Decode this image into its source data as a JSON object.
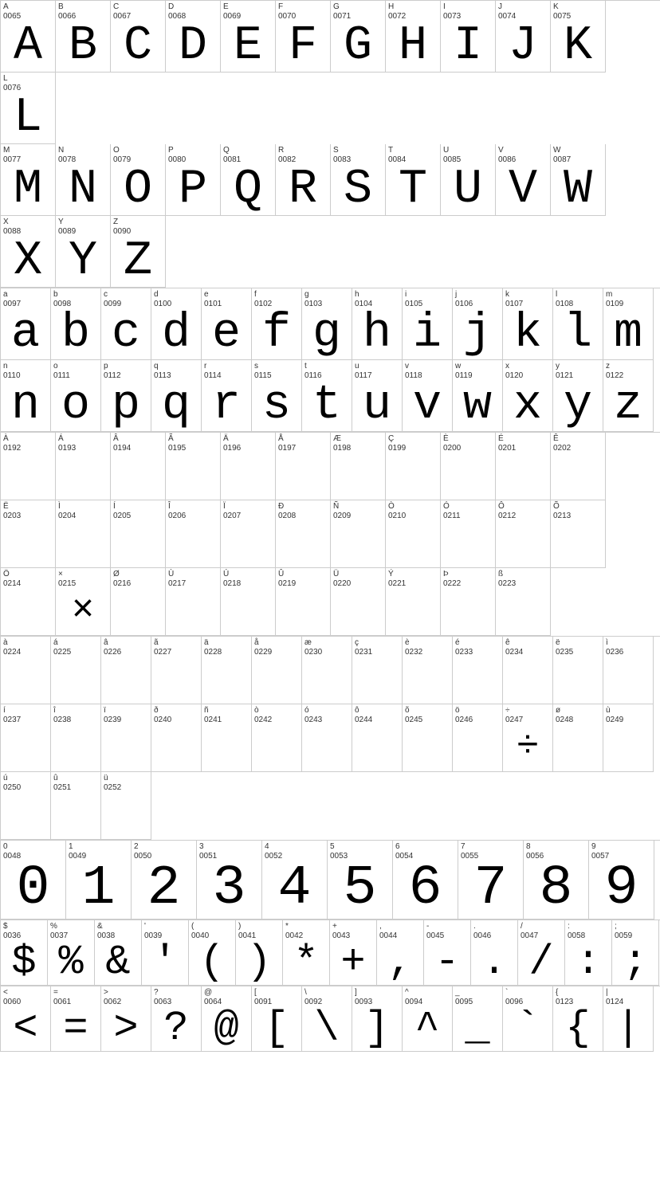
{
  "sections": [
    {
      "id": "uppercase",
      "rows": [
        {
          "cols": 12,
          "cells": [
            {
              "code": "A\n0065",
              "char": "A"
            },
            {
              "code": "B\n0066",
              "char": "B"
            },
            {
              "code": "C\n0067",
              "char": "C"
            },
            {
              "code": "D\n0068",
              "char": "D"
            },
            {
              "code": "E\n0069",
              "char": "E"
            },
            {
              "code": "F\n0070",
              "char": "F"
            },
            {
              "code": "G\n0071",
              "char": "G"
            },
            {
              "code": "H\n0072",
              "char": "H"
            },
            {
              "code": "I\n0073",
              "char": "I"
            },
            {
              "code": "J\n0074",
              "char": "J"
            },
            {
              "code": "K\n0075",
              "char": "K"
            },
            {
              "code": "L\n0076",
              "char": "L"
            }
          ]
        },
        {
          "cols": 12,
          "cells": [
            {
              "code": "M\n0077",
              "char": "M"
            },
            {
              "code": "N\n0078",
              "char": "N"
            },
            {
              "code": "O\n0079",
              "char": "O"
            },
            {
              "code": "P\n0080",
              "char": "P"
            },
            {
              "code": "Q\n0081",
              "char": "Q"
            },
            {
              "code": "R\n0082",
              "char": "R"
            },
            {
              "code": "S\n0083",
              "char": "S"
            },
            {
              "code": "T\n0084",
              "char": "T"
            },
            {
              "code": "U\n0085",
              "char": "U"
            },
            {
              "code": "V\n0086",
              "char": "V"
            },
            {
              "code": "W\n0087",
              "char": "W"
            }
          ]
        },
        {
          "cols": 12,
          "cells": [
            {
              "code": "X\n0088",
              "char": "X"
            },
            {
              "code": "Y\n0089",
              "char": "Y"
            },
            {
              "code": "Z\n0090",
              "char": "Z"
            }
          ]
        }
      ]
    },
    {
      "id": "lowercase",
      "rows": [
        {
          "cols": 13,
          "cells": [
            {
              "code": "a\n0097",
              "char": "a"
            },
            {
              "code": "b\n0098",
              "char": "b"
            },
            {
              "code": "c\n0099",
              "char": "c"
            },
            {
              "code": "d\n0100",
              "char": "d"
            },
            {
              "code": "e\n0101",
              "char": "e"
            },
            {
              "code": "f\n0102",
              "char": "f"
            },
            {
              "code": "g\n0103",
              "char": "g"
            },
            {
              "code": "h\n0104",
              "char": "h"
            },
            {
              "code": "i\n0105",
              "char": "i"
            },
            {
              "code": "j\n0106",
              "char": "j"
            },
            {
              "code": "k\n0107",
              "char": "k"
            },
            {
              "code": "l\n0108",
              "char": "l"
            },
            {
              "code": "m\n0109",
              "char": "m"
            }
          ]
        },
        {
          "cols": 13,
          "cells": [
            {
              "code": "n\n0110",
              "char": "n"
            },
            {
              "code": "o\n0111",
              "char": "o"
            },
            {
              "code": "p\n0112",
              "char": "p"
            },
            {
              "code": "q\n0113",
              "char": "q"
            },
            {
              "code": "r\n0114",
              "char": "r"
            },
            {
              "code": "s\n0115",
              "char": "s"
            },
            {
              "code": "t\n0116",
              "char": "t"
            },
            {
              "code": "u\n0117",
              "char": "u"
            },
            {
              "code": "v\n0118",
              "char": "v"
            },
            {
              "code": "w\n0119",
              "char": "w"
            },
            {
              "code": "x\n0120",
              "char": "x"
            },
            {
              "code": "y\n0121",
              "char": "y"
            },
            {
              "code": "z\n0122",
              "char": "z"
            }
          ]
        }
      ]
    },
    {
      "id": "extended1",
      "rows": [
        {
          "cols": 12,
          "cells": [
            {
              "code": "À\n0192",
              "char": ""
            },
            {
              "code": "Á\n0193",
              "char": ""
            },
            {
              "code": "Â\n0194",
              "char": ""
            },
            {
              "code": "Ã\n0195",
              "char": ""
            },
            {
              "code": "Ä\n0196",
              "char": ""
            },
            {
              "code": "Å\n0197",
              "char": ""
            },
            {
              "code": "Æ\n0198",
              "char": ""
            },
            {
              "code": "Ç\n0199",
              "char": ""
            },
            {
              "code": "È\n0200",
              "char": ""
            },
            {
              "code": "É\n0201",
              "char": ""
            },
            {
              "code": "Ê\n0202",
              "char": ""
            }
          ]
        },
        {
          "cols": 12,
          "cells": [
            {
              "code": "Ë\n0203",
              "char": ""
            },
            {
              "code": "Ì\n0204",
              "char": ""
            },
            {
              "code": "Í\n0205",
              "char": ""
            },
            {
              "code": "Î\n0206",
              "char": ""
            },
            {
              "code": "Ï\n0207",
              "char": ""
            },
            {
              "code": "Ð\n0208",
              "char": ""
            },
            {
              "code": "Ñ\n0209",
              "char": ""
            },
            {
              "code": "Ò\n0210",
              "char": ""
            },
            {
              "code": "Ó\n0211",
              "char": ""
            },
            {
              "code": "Ô\n0212",
              "char": ""
            },
            {
              "code": "Õ\n0213",
              "char": ""
            }
          ]
        },
        {
          "cols": 12,
          "cells": [
            {
              "code": "Ö\n0214",
              "char": ""
            },
            {
              "code": "×\n0215",
              "char": "×"
            },
            {
              "code": "Ø\n0216",
              "char": ""
            },
            {
              "code": "Ù\n0217",
              "char": ""
            },
            {
              "code": "Ú\n0218",
              "char": ""
            },
            {
              "code": "Û\n0219",
              "char": ""
            },
            {
              "code": "Ü\n0220",
              "char": ""
            },
            {
              "code": "Ý\n0221",
              "char": ""
            },
            {
              "code": "Þ\n0222",
              "char": ""
            },
            {
              "code": "ß\n0223",
              "char": ""
            }
          ]
        }
      ]
    },
    {
      "id": "extended2",
      "rows": [
        {
          "cols": 13,
          "cells": [
            {
              "code": "à\n0224",
              "char": ""
            },
            {
              "code": "á\n0225",
              "char": ""
            },
            {
              "code": "â\n0226",
              "char": ""
            },
            {
              "code": "ã\n0227",
              "char": ""
            },
            {
              "code": "ä\n0228",
              "char": ""
            },
            {
              "code": "å\n0229",
              "char": ""
            },
            {
              "code": "æ\n0230",
              "char": ""
            },
            {
              "code": "ç\n0231",
              "char": ""
            },
            {
              "code": "è\n0232",
              "char": ""
            },
            {
              "code": "é\n0233",
              "char": ""
            },
            {
              "code": "ê\n0234",
              "char": ""
            },
            {
              "code": "ë\n0235",
              "char": ""
            },
            {
              "code": "ì\n0236",
              "char": ""
            }
          ]
        },
        {
          "cols": 13,
          "cells": [
            {
              "code": "í\n0237",
              "char": ""
            },
            {
              "code": "î\n0238",
              "char": ""
            },
            {
              "code": "ï\n0239",
              "char": ""
            },
            {
              "code": "ð\n0240",
              "char": ""
            },
            {
              "code": "ñ\n0241",
              "char": ""
            },
            {
              "code": "ò\n0242",
              "char": ""
            },
            {
              "code": "ó\n0243",
              "char": ""
            },
            {
              "code": "ô\n0244",
              "char": ""
            },
            {
              "code": "õ\n0245",
              "char": ""
            },
            {
              "code": "ö\n0246",
              "char": ""
            },
            {
              "code": "÷\n0247",
              "char": "÷"
            },
            {
              "code": "ø\n0248",
              "char": ""
            },
            {
              "code": "ù\n0249",
              "char": ""
            }
          ]
        },
        {
          "cols": 13,
          "cells": [
            {
              "code": "ú\n0250",
              "char": ""
            },
            {
              "code": "û\n0251",
              "char": ""
            },
            {
              "code": "ü\n0252",
              "char": ""
            }
          ]
        }
      ]
    },
    {
      "id": "numbers",
      "rows": [
        {
          "cols": 10,
          "cells": [
            {
              "code": "0\n0048",
              "char": "0"
            },
            {
              "code": "1\n0049",
              "char": "1"
            },
            {
              "code": "2\n0050",
              "char": "2"
            },
            {
              "code": "3\n0051",
              "char": "3"
            },
            {
              "code": "4\n0052",
              "char": "4"
            },
            {
              "code": "5\n0053",
              "char": "5"
            },
            {
              "code": "6\n0054",
              "char": "6"
            },
            {
              "code": "7\n0055",
              "char": "7"
            },
            {
              "code": "8\n0056",
              "char": "8"
            },
            {
              "code": "9\n0057",
              "char": "9"
            }
          ]
        }
      ]
    },
    {
      "id": "specials1",
      "rows": [
        {
          "cols": 14,
          "cells": [
            {
              "code": "$\n0036",
              "char": "$"
            },
            {
              "code": "%\n0037",
              "char": "%"
            },
            {
              "code": "&\n0038",
              "char": "&"
            },
            {
              "code": "'\n0039",
              "char": "'"
            },
            {
              "code": "(\n0040",
              "char": "("
            },
            {
              "code": ")\n0041",
              "char": ")"
            },
            {
              "code": "*\n0042",
              "char": "*"
            },
            {
              "code": "+\n0043",
              "char": "+"
            },
            {
              "code": ",\n0044",
              "char": ","
            },
            {
              "code": "-\n0045",
              "char": "-"
            },
            {
              "code": ".\n0046",
              "char": "."
            },
            {
              "code": "/\n0047",
              "char": "/"
            },
            {
              "code": ":\n0058",
              "char": ":"
            },
            {
              "code": ";\n0059",
              "char": ";"
            }
          ]
        }
      ]
    },
    {
      "id": "specials2",
      "rows": [
        {
          "cols": 13,
          "cells": [
            {
              "code": "<\n0060",
              "char": "<"
            },
            {
              "code": "=\n0061",
              "char": "="
            },
            {
              "code": ">\n0062",
              "char": ">"
            },
            {
              "code": "?\n0063",
              "char": "?"
            },
            {
              "code": "@\n0064",
              "char": "@"
            },
            {
              "code": "[\n0091",
              "char": "["
            },
            {
              "code": "\\\n0092",
              "char": "\\"
            },
            {
              "code": "]\n0093",
              "char": "]"
            },
            {
              "code": "^\n0094",
              "char": "^"
            },
            {
              "code": "_\n0095",
              "char": "_"
            },
            {
              "code": "`\n0096",
              "char": "`"
            },
            {
              "code": "{\n0123",
              "char": "{"
            },
            {
              "code": "|\n0124",
              "char": "|"
            }
          ]
        }
      ]
    }
  ]
}
